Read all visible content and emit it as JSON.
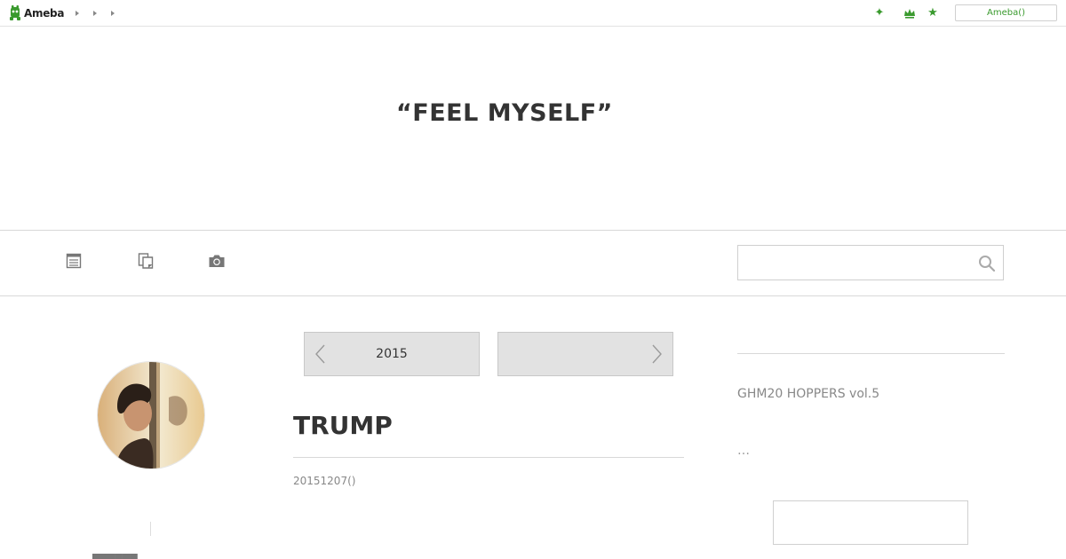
{
  "topbar": {
    "logo_text": "Ameba",
    "breadcrumbs": [
      "",
      "",
      ""
    ],
    "icons": [
      "sparkle-icon",
      "crown-icon",
      "star-icon"
    ],
    "ameba_button": "Ameba()",
    "accent_color": "#3a9a2e"
  },
  "header": {
    "blog_title": "“FEEL MYSELF”"
  },
  "nav": {
    "icons": [
      "entry-list-icon",
      "theme-list-icon",
      "photo-icon"
    ],
    "search": {
      "placeholder": "",
      "value": ""
    }
  },
  "pager": {
    "prev_label": "2015",
    "next_label": ""
  },
  "entry": {
    "title": "TRUMP",
    "date": "20151207()"
  },
  "sidebar": {
    "link_text": "GHM20 HOPPERS vol.5",
    "more_text": "…"
  }
}
